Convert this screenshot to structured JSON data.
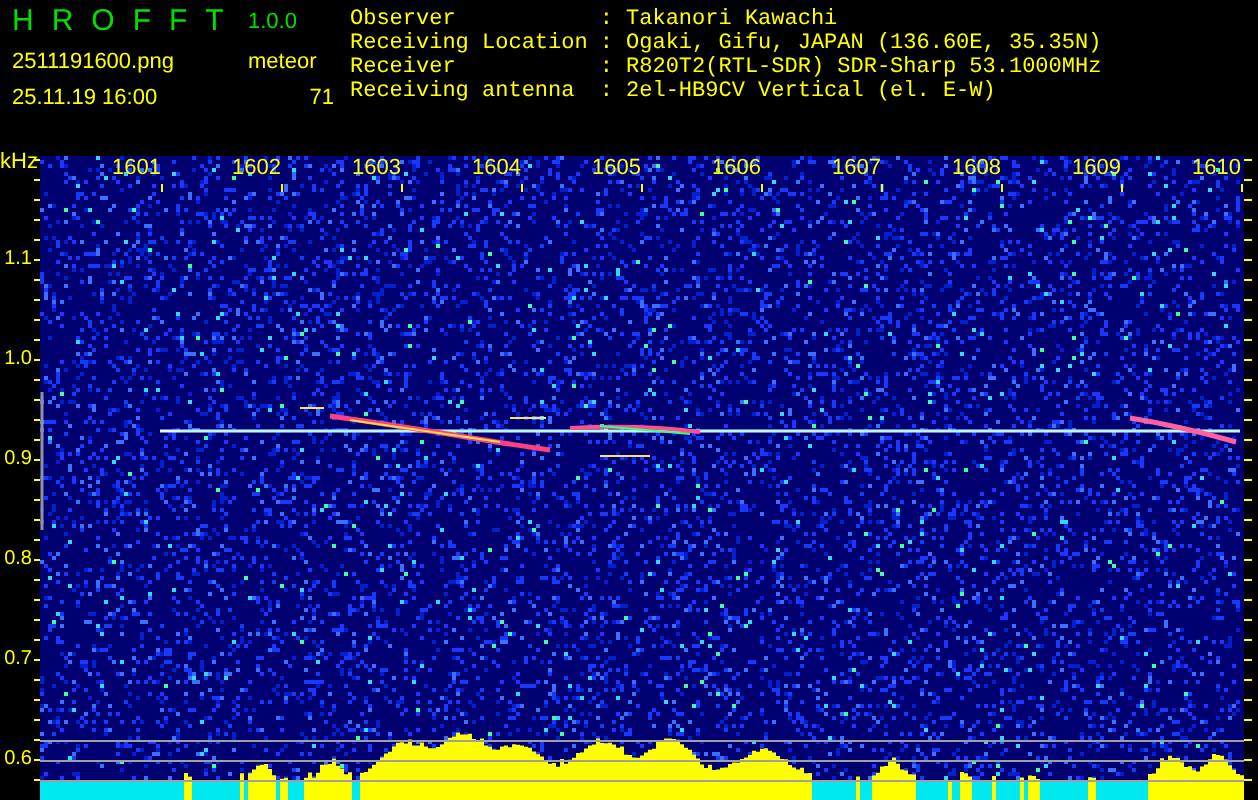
{
  "header": {
    "app_name": "HROFFT",
    "version": "1.0.0",
    "file_name": "2511191600.png",
    "timestamp": "25.11.19 16:00",
    "count_label": "meteor",
    "count": "71"
  },
  "station_info": [
    {
      "label": "Observer",
      "value": ": Takanori Kawachi"
    },
    {
      "label": "Receiving Location",
      "value": ": Ogaki, Gifu, JAPAN (136.60E, 35.35N)"
    },
    {
      "label": "Receiver",
      "value": ": R820T2(RTL-SDR) SDR-Sharp 53.1000MHz"
    },
    {
      "label": "Receiving antenna",
      "value": ": 2el-HB9CV Vertical (el. E-W)"
    }
  ],
  "spectrogram": {
    "y_unit": "kHz",
    "x_labels": [
      "1601",
      "1602",
      "1603",
      "1604",
      "1605",
      "1606",
      "1607",
      "1608",
      "1609",
      "1610"
    ],
    "y_labels": [
      "1.1",
      "1.0",
      "0.9",
      "0.8",
      "0.7",
      "0.6"
    ]
  }
}
